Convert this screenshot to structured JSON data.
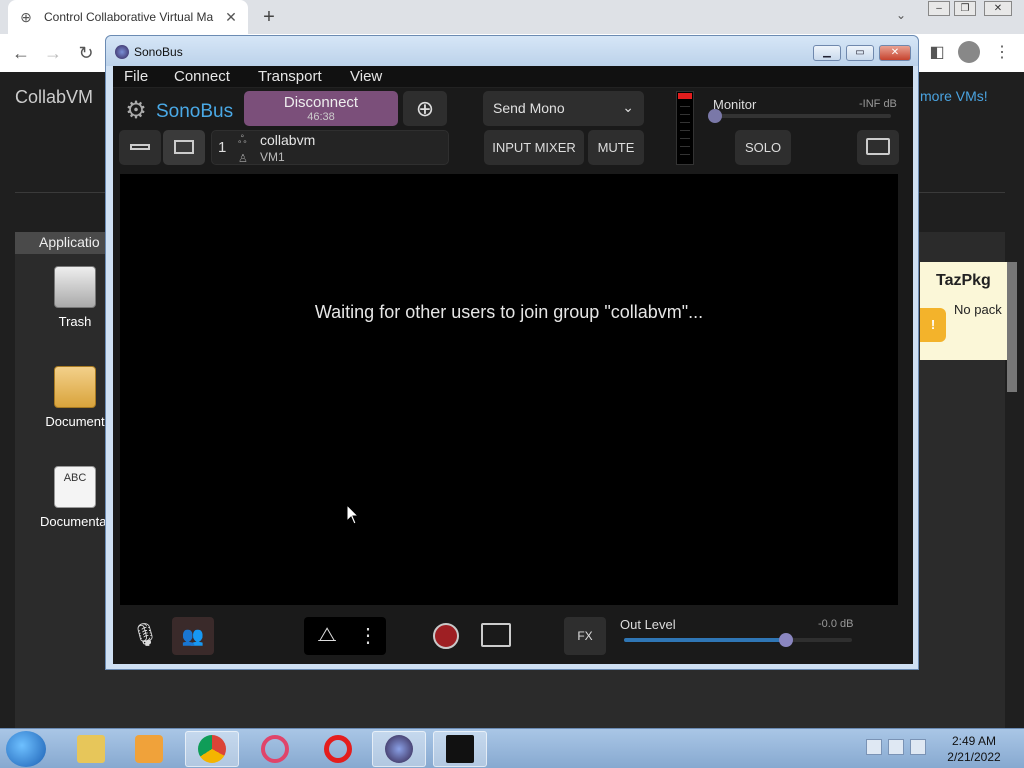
{
  "browser": {
    "tab_title": "Control Collaborative Virtual Ma",
    "new_tab": "+",
    "tab_close": "✕"
  },
  "page": {
    "site_title": "CollabVM",
    "more_vms": "more VMs!"
  },
  "desktop": {
    "apps_label": "Applicatio",
    "icons": [
      {
        "label": "Trash"
      },
      {
        "label": "Document"
      },
      {
        "label": "Documentat",
        "glyph": "ABC"
      }
    ],
    "tazpkg": {
      "title": "TazPkg",
      "text": "No pack"
    }
  },
  "taskbar": {
    "time": "2:49 AM",
    "date": "2/21/2022"
  },
  "sonobus": {
    "window_title": "SonoBus",
    "menu": [
      "File",
      "Connect",
      "Transport",
      "View"
    ],
    "brand": "SonoBus",
    "disconnect_label": "Disconnect",
    "session_time": "46:38",
    "send_mode": "Send Mono",
    "input_mixer": "INPUT MIXER",
    "mute": "MUTE",
    "solo": "SOLO",
    "monitor_label": "Monitor",
    "monitor_db": "-INF dB",
    "monitor_level": 0.0,
    "group_count": "1",
    "group_name": "collabvm",
    "user_name": "VM1",
    "waiting_text": "Waiting for other users to join group \"collabvm\"...",
    "fx": "FX",
    "out_level_label": "Out Level",
    "out_level_db": "-0.0 dB",
    "out_level": 0.71,
    "colors": {
      "accent": "#4aa9e6",
      "disconnect": "#7b4f7a",
      "record": "#9e1f23",
      "meter_peak": "#e21d1d"
    }
  }
}
